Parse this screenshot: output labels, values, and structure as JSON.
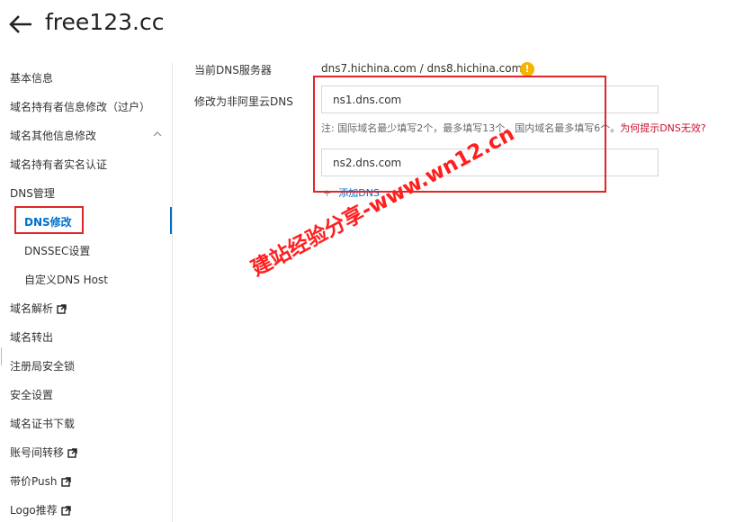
{
  "header": {
    "title": "free123.cc"
  },
  "sidebar": {
    "items": [
      {
        "label": "基本信息"
      },
      {
        "label": "域名持有者信息修改（过户）"
      },
      {
        "label": "域名其他信息修改"
      },
      {
        "label": "域名持有者实名认证"
      },
      {
        "label": "DNS管理"
      },
      {
        "label": "DNS修改"
      },
      {
        "label": "DNSSEC设置"
      },
      {
        "label": "自定义DNS Host"
      },
      {
        "label": "域名解析"
      },
      {
        "label": "域名转出"
      },
      {
        "label": "注册局安全锁"
      },
      {
        "label": "安全设置"
      },
      {
        "label": "域名证书下载"
      },
      {
        "label": "账号间转移"
      },
      {
        "label": "带价Push"
      },
      {
        "label": "Logo推荐"
      }
    ]
  },
  "main": {
    "current_dns_label": "当前DNS服务器",
    "current_dns_value": "dns7.hichina.com / dns8.hichina.com",
    "change_dns_label": "修改为非阿里云DNS",
    "dns_inputs": [
      {
        "value": "ns1.dns.com"
      },
      {
        "value": "ns2.dns.com"
      }
    ],
    "note_text": "注:   国际域名最少填写2个，最多填写13个，国内域名最多填写6个。",
    "note_link": "为何提示DNS无效?",
    "add_link": "添加DNS"
  },
  "watermark": {
    "text": "建站经验分享-www.wn12.cn"
  },
  "colors": {
    "accent": "#0070cc",
    "annotation_red": "#e0252b",
    "warning": "#f5b400"
  }
}
